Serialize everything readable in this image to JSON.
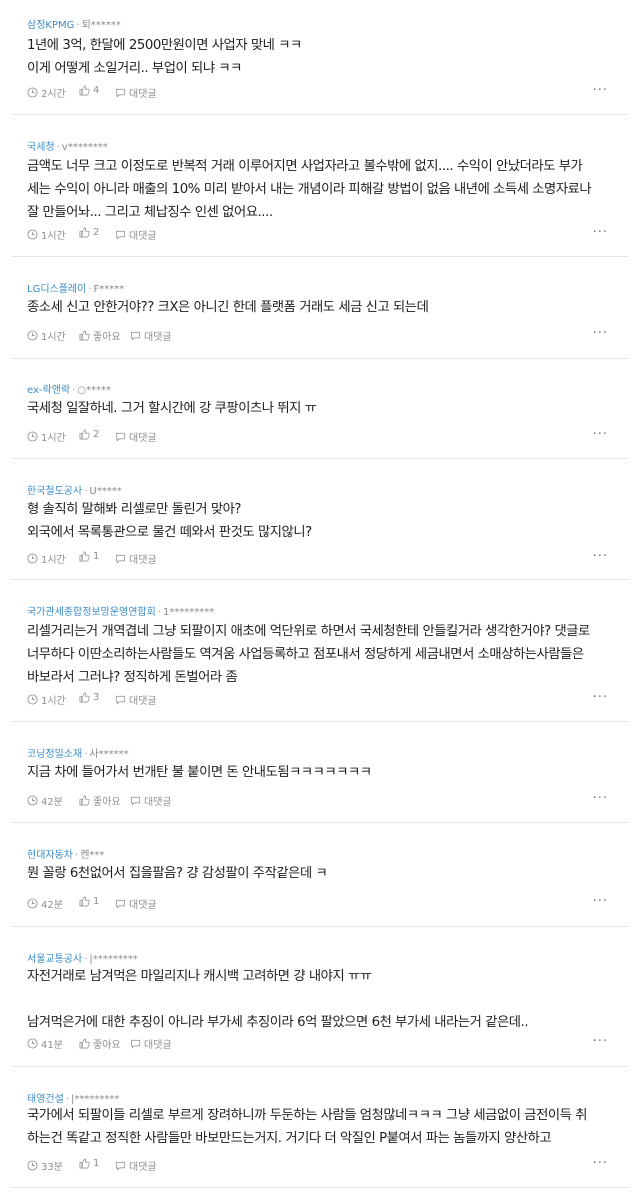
{
  "ui": {
    "reply_label": "대댓글",
    "more_label": "···"
  },
  "comments": [
    {
      "company": "삼정KPMG",
      "author": "퇴******",
      "lines": [
        "1년에 3억, 한달에 2500만원이면 사업자 맞네 ㅋㅋ",
        "이게 어떻게 소일거리.. 부업이 되냐 ㅋㅋ"
      ],
      "time": "2시간",
      "likes": "4"
    },
    {
      "company": "국세청",
      "author": "v********",
      "lines": [
        "금액도 너무 크고 이정도로 반복적 거래 이루어지면 사업자라고 볼수밖에 없지.... 수익이 안났더라도 부가",
        "세는 수익이 아니라 매출의 10% 미리 받아서 내는 개념이라 피해갈 방법이 없음 내년에 소득세 소명자료나",
        "잘 만들어놔... 그리고 체납징수 인센 없어요...."
      ],
      "time": "1시간",
      "likes": "2"
    },
    {
      "company": "LG디스플레이",
      "author": "F*****",
      "lines": [
        "종소세 신고 안한거야?? 크X은 아니긴 한데 플랫폼 거래도 세금 신고 되는데"
      ],
      "time": "1시간",
      "likes": "좋아요"
    },
    {
      "company": "ex-락앤락",
      "author": "○*****",
      "lines": [
        "국세청 일잘하네. 그거 할시간에 강 쿠팡이츠나 뛰지 ㅠ"
      ],
      "time": "1시간",
      "likes": "2"
    },
    {
      "company": "한국철도공사",
      "author": "U*****",
      "lines": [
        "형 솔직히 말해봐 리셀로만 돌린거 맞아?",
        "외국에서 목록통관으로 물건 떼와서 판것도 많지않니?"
      ],
      "time": "1시간",
      "likes": "1"
    },
    {
      "company": "국가관세종합정보망운영연합회",
      "author": "1*********",
      "lines": [
        "리셀거리는거 개역겹네 그냥 되팔이지 애초에 억단위로 하면서 국세청한테 안들킬거라 생각한거야? 댓글로",
        "너무하다 이딴소리하는사람들도 역겨움 사업등록하고 점포내서 정당하게 세금내면서 소매상하는사람들은",
        "바보라서 그러냐? 정직하게 돈벌어라 좀"
      ],
      "time": "1시간",
      "likes": "3"
    },
    {
      "company": "코닝정밀소재",
      "author": "사******",
      "lines": [
        "지금 차에 들어가서 번개탄 불 붙이면 돈 안내도됨ㅋㅋㅋㅋㅋㅋㅋ"
      ],
      "time": "42분",
      "likes": "좋아요"
    },
    {
      "company": "현대자동차",
      "author": "켄***",
      "lines": [
        "뭔 꼴랑 6천없어서 집을팔음? 걍 감성팔이 주작같은데 ㅋ"
      ],
      "time": "42분",
      "likes": "1"
    },
    {
      "company": "서울교통공사",
      "author": "|*********",
      "lines": [
        "자전거래로 남겨먹은 마일리지나 캐시백 고려하면 걍 내야지 ㅠㅠ",
        "",
        "남겨먹은거에 대한 추징이 아니라 부가세 추징이라 6억 팔았으면 6천 부가세 내라는거 같은데.."
      ],
      "time": "41분",
      "likes": "좋아요"
    },
    {
      "company": "태영건설",
      "author": "|*********",
      "lines": [
        "국가에서 되팔이들 리셀로 부르게 장려하니까 두둔하는 사람들 엄청많네ㅋㅋㅋ 그냥 세금없이 금전이득 취",
        "하는건 똑같고 정직한 사람들만 바보만드는거지. 거기다 더 악질인 P붙여서 파는 놈들까지 양산하고"
      ],
      "time": "33분",
      "likes": "1"
    }
  ]
}
